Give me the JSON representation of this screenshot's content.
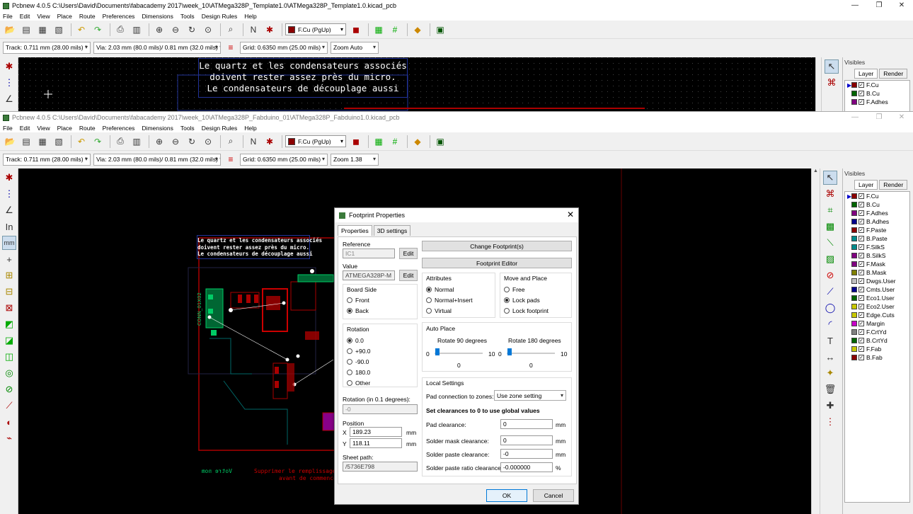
{
  "window1": {
    "title": "Pcbnew 4.0.5 C:\\Users\\David\\Documents\\fabacademy 2017\\week_10\\ATMega328P_Template1.0\\ATMega328P_Template1.0.kicad_pcb",
    "menu": [
      "File",
      "Edit",
      "View",
      "Place",
      "Route",
      "Preferences",
      "Dimensions",
      "Tools",
      "Design Rules",
      "Help"
    ],
    "layer_select": "F.Cu (PgUp)",
    "track": "Track: 0.711 mm (28.00 mils) *",
    "via": "Via: 2.03 mm (80.0 mils)/ 0.81 mm (32.0 mils) *",
    "grid": "Grid: 0.6350 mm (25.00 mils)",
    "zoom": "Zoom Auto",
    "note_lines": [
      "Le quartz et les condensateurs associés",
      "doivent rester assez près du micro.",
      "Le condensateurs de découplage aussi"
    ],
    "visibles_label": "Visibles",
    "tabs": [
      "Layer",
      "Render"
    ],
    "layers": [
      {
        "name": "F.Cu",
        "color": "#8b0000"
      },
      {
        "name": "B.Cu",
        "color": "#006400"
      },
      {
        "name": "F.Adhes",
        "color": "#800080"
      }
    ]
  },
  "window2": {
    "title": "Pcbnew 4.0.5 C:\\Users\\David\\Documents\\fabacademy 2017\\week_10\\ATMega328P_Fabduino_01\\ATMega328P_Fabduino1.0.kicad_pcb",
    "menu": [
      "File",
      "Edit",
      "View",
      "Place",
      "Route",
      "Preferences",
      "Dimensions",
      "Tools",
      "Design Rules",
      "Help"
    ],
    "layer_select": "F.Cu (PgUp)",
    "track": "Track: 0.711 mm (28.00 mils) *",
    "via": "Via: 2.03 mm (80.0 mils)/ 0.81 mm (32.0 mils) *",
    "grid": "Grid: 0.6350 mm (25.00 mils)",
    "zoom": "Zoom 1.38",
    "note_lines": [
      "Le quartz et les condensateurs associés",
      "doivent rester assez près du micro.",
      "Le condensateurs de découplage aussi"
    ],
    "board_labels": {
      "conn": "CONN_01X02",
      "bottom_left": "Votre nom",
      "bottom_red1": "Supprimer le remplissage d",
      "bottom_red2": "avant de commence"
    },
    "visibles_label": "Visibles",
    "tabs": [
      "Layer",
      "Render"
    ],
    "layers": [
      {
        "name": "F.Cu",
        "color": "#8b0000"
      },
      {
        "name": "B.Cu",
        "color": "#006400"
      },
      {
        "name": "F.Adhes",
        "color": "#800080"
      },
      {
        "name": "B.Adhes",
        "color": "#00008b"
      },
      {
        "name": "F.Paste",
        "color": "#8b0000"
      },
      {
        "name": "B.Paste",
        "color": "#008b8b"
      },
      {
        "name": "F.SilkS",
        "color": "#008b8b"
      },
      {
        "name": "B.SilkS",
        "color": "#800080"
      },
      {
        "name": "F.Mask",
        "color": "#800080"
      },
      {
        "name": "B.Mask",
        "color": "#808000"
      },
      {
        "name": "Dwgs.User",
        "color": "#c0c0c0"
      },
      {
        "name": "Cmts.User",
        "color": "#00008b"
      },
      {
        "name": "Eco1.User",
        "color": "#006400"
      },
      {
        "name": "Eco2.User",
        "color": "#c8c800"
      },
      {
        "name": "Edge.Cuts",
        "color": "#c8c800"
      },
      {
        "name": "Margin",
        "color": "#c800c8"
      },
      {
        "name": "F.CrtYd",
        "color": "#808080"
      },
      {
        "name": "B.CrtYd",
        "color": "#006400"
      },
      {
        "name": "F.Fab",
        "color": "#c8c800"
      },
      {
        "name": "B.Fab",
        "color": "#8b0000"
      }
    ]
  },
  "dialog": {
    "title": "Footprint Properties",
    "tabs": [
      "Properties",
      "3D settings"
    ],
    "reference_label": "Reference",
    "reference_value": "IC1",
    "edit_label": "Edit",
    "value_label": "Value",
    "value_value": "ATMEGA328P-M",
    "board_side_label": "Board Side",
    "board_side_options": [
      "Front",
      "Back"
    ],
    "board_side_selected": "Back",
    "rotation_label": "Rotation",
    "rotation_options": [
      "0.0",
      "+90.0",
      "-90.0",
      "180.0",
      "Other"
    ],
    "rotation_selected": "0.0",
    "rotation_custom_label": "Rotation (in 0.1 degrees):",
    "rotation_custom_value": "-0",
    "position_label": "Position",
    "pos_x_label": "X",
    "pos_x": "189.23",
    "pos_y_label": "Y",
    "pos_y": "118.11",
    "unit_mm": "mm",
    "sheet_path_label": "Sheet path:",
    "sheet_path": "/5736E798",
    "change_footprint": "Change Footprint(s)",
    "footprint_editor": "Footprint Editor",
    "attributes_label": "Attributes",
    "attributes_options": [
      "Normal",
      "Normal+Insert",
      "Virtual"
    ],
    "attributes_selected": "Normal",
    "move_place_label": "Move and Place",
    "move_options": [
      "Free",
      "Lock pads",
      "Lock footprint"
    ],
    "move_selected": "Lock pads",
    "auto_place_label": "Auto Place",
    "rot90_label": "Rotate 90 degrees",
    "rot180_label": "Rotate 180 degrees",
    "slider_min": "0",
    "slider_max": "10",
    "slider_value": "0",
    "local_settings_label": "Local Settings",
    "pad_zone_label": "Pad connection to zones:",
    "pad_zone_value": "Use zone setting",
    "clearance_note": "Set clearances to 0 to use global values",
    "pad_clearance_label": "Pad clearance:",
    "pad_clearance": "0",
    "mask_clearance_label": "Solder mask clearance:",
    "mask_clearance": "0",
    "paste_clearance_label": "Solder paste clearance:",
    "paste_clearance": "-0",
    "paste_ratio_label": "Solder paste ratio clearance:",
    "paste_ratio": "-0.000000",
    "unit_pct": "%",
    "ok": "OK",
    "cancel": "Cancel"
  }
}
